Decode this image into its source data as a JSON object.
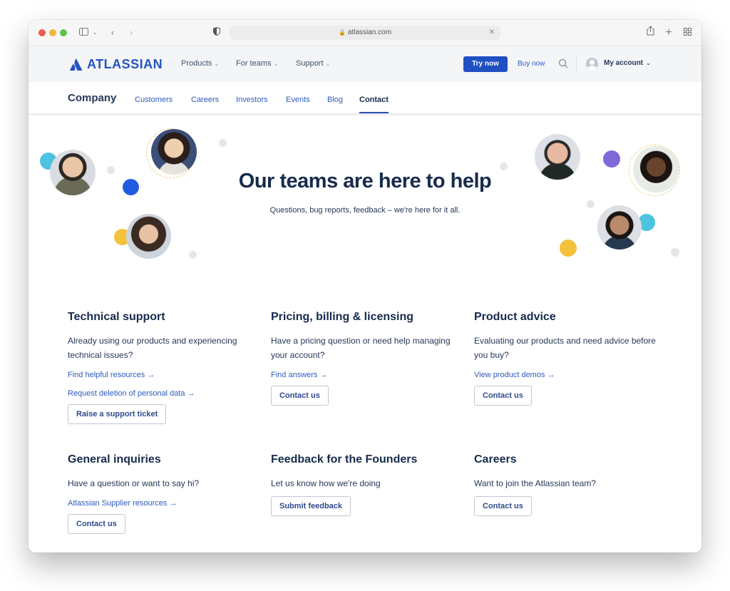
{
  "browser": {
    "url": "atlassian.com",
    "icons": [
      "sidebar-icon",
      "chevron-down-icon",
      "back-icon",
      "forward-icon",
      "shield-icon",
      "lock-icon",
      "clear-icon",
      "share-icon",
      "new-tab-icon",
      "tab-overview-icon"
    ]
  },
  "header": {
    "brand": "ATLASSIAN",
    "nav": [
      {
        "label": "Products"
      },
      {
        "label": "For teams"
      },
      {
        "label": "Support"
      }
    ],
    "try_now": "Try now",
    "buy_now": "Buy now",
    "account": "My account",
    "chevron": "⌄",
    "brand_color": "#2353c1"
  },
  "subnav": {
    "title": "Company",
    "items": [
      {
        "label": "Customers"
      },
      {
        "label": "Careers"
      },
      {
        "label": "Investors"
      },
      {
        "label": "Events"
      },
      {
        "label": "Blog"
      },
      {
        "label": "Contact",
        "active": true
      }
    ]
  },
  "hero": {
    "title": "Our teams are here to help",
    "subtitle": "Questions, bug reports, feedback – we're here for it all."
  },
  "cards": [
    {
      "title": "Technical support",
      "desc": "Already using our products and experiencing technical issues?",
      "links": [
        "Find helpful resources →",
        "Request deletion of personal data →"
      ],
      "button": "Raise a support ticket"
    },
    {
      "title": "Pricing, billing & licensing",
      "desc": "Have a pricing question or need help managing your account?",
      "links": [
        "Find answers →"
      ],
      "button": "Contact us"
    },
    {
      "title": "Product advice",
      "desc": "Evaluating our products and need advice before you buy?",
      "links": [
        "View product demos →"
      ],
      "button": "Contact us"
    },
    {
      "title": "General inquiries",
      "desc": "Have a question or want to say hi?",
      "links": [
        "Atlassian Supplier resources →"
      ],
      "button": "Contact us"
    },
    {
      "title": "Feedback for the Founders",
      "desc": "Let us know how we're doing",
      "links": [],
      "button": "Submit feedback"
    },
    {
      "title": "Careers",
      "desc": "Want to join the Atlassian team?",
      "links": [],
      "button": "Contact us"
    }
  ]
}
